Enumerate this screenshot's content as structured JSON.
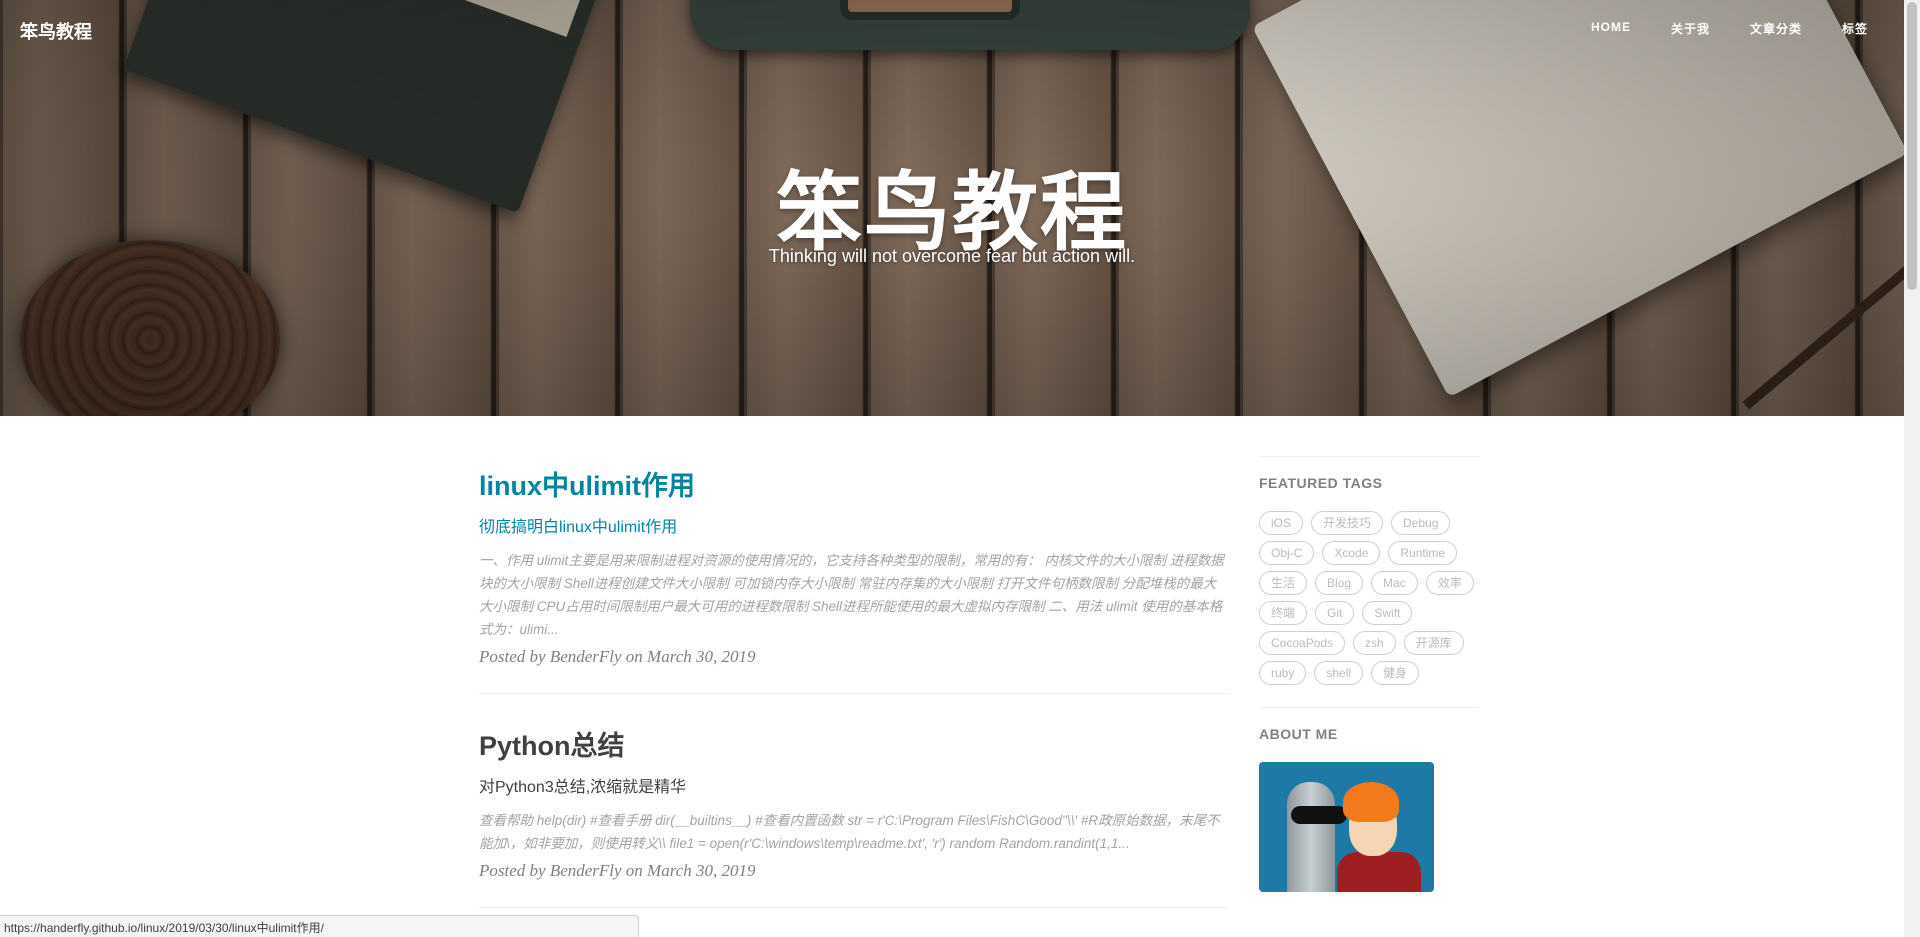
{
  "navbar": {
    "brand": "笨鸟教程",
    "links": [
      {
        "label": "HOME"
      },
      {
        "label": "关于我"
      },
      {
        "label": "文章分类"
      },
      {
        "label": "标签"
      }
    ]
  },
  "hero": {
    "title": "笨鸟教程",
    "subtitle": "Thinking will not overcome fear but action will."
  },
  "posts": [
    {
      "title": "linux中ulimit作用",
      "subtitle": "彻底搞明白linux中ulimit作用",
      "excerpt": "一、作用 ulimit主要是用来限制进程对资源的使用情况的，它支持各种类型的限制，常用的有： 内核文件的大小限制 进程数据块的大小限制 Shell进程创建文件大小限制 可加锁内存大小限制 常驻内存集的大小限制 打开文件句柄数限制 分配堆栈的最大大小限制 CPU占用时间限制用户最大可用的进程数限制 Shell进程所能使用的最大虚拟内存限制 二、用法 ulimit 使用的基本格式为：ulimi...",
      "meta": "Posted by BenderFly on March 30, 2019"
    },
    {
      "title": "Python总结",
      "subtitle": "对Python3总结,浓缩就是精华",
      "excerpt": "查看帮助 help(dir) #查看手册 dir(__builtins__) #查看内置函数 str = r'C:\\Program Files\\FishC\\Good''\\\\' #R政原始数据，末尾不能加\\，如非要加，则使用转义\\\\ file1 = open(r'C:\\windows\\temp\\readme.txt', 'r') random Random.randint(1,1...",
      "meta": "Posted by BenderFly on March 30, 2019"
    }
  ],
  "sidebar": {
    "featured_tags_heading": "FEATURED TAGS",
    "tags": [
      "iOS",
      "开发技巧",
      "Debug",
      "Obj-C",
      "Xcode",
      "Runtime",
      "生活",
      "Blog",
      "Mac",
      "效率",
      "终端",
      "Git",
      "Swift",
      "CocoaPods",
      "zsh",
      "开源库",
      "ruby",
      "shell",
      "健身"
    ],
    "about_heading": "ABOUT ME"
  },
  "status_url": "https://handerfly.github.io/linux/2019/03/30/linux中ulimit作用/",
  "colors": {
    "accent": "#0085a1",
    "text": "#404040",
    "muted": "#a3a3a3"
  }
}
